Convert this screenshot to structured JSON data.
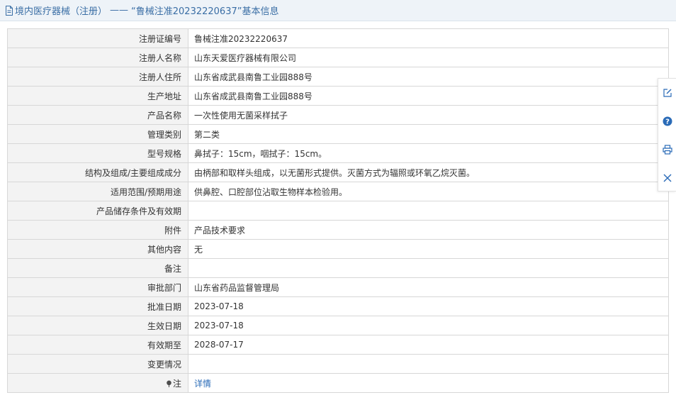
{
  "header": {
    "category": "境内医疗器械（注册）",
    "separator": "——",
    "title": "“鲁械注准20232220637”基本信息"
  },
  "rows": [
    {
      "label": "注册证编号",
      "value": "鲁械注准20232220637"
    },
    {
      "label": "注册人名称",
      "value": "山东天爱医疗器械有限公司"
    },
    {
      "label": "注册人住所",
      "value": "山东省成武县南鲁工业园888号"
    },
    {
      "label": "生产地址",
      "value": "山东省成武县南鲁工业园888号"
    },
    {
      "label": "产品名称",
      "value": "一次性使用无菌采样拭子"
    },
    {
      "label": "管理类别",
      "value": "第二类"
    },
    {
      "label": "型号规格",
      "value": "鼻拭子：15cm，咽拭子：15cm。"
    },
    {
      "label": "结构及组成/主要组成成分",
      "value": "由柄部和取样头组成，以无菌形式提供。灭菌方式为辐照或环氧乙烷灭菌。"
    },
    {
      "label": "适用范围/预期用途",
      "value": "供鼻腔、口腔部位沾取生物样本检验用。"
    },
    {
      "label": "产品储存条件及有效期",
      "value": ""
    },
    {
      "label": "附件",
      "value": "产品技术要求"
    },
    {
      "label": "其他内容",
      "value": "无"
    },
    {
      "label": "备注",
      "value": ""
    },
    {
      "label": "审批部门",
      "value": "山东省药品监督管理局"
    },
    {
      "label": "批准日期",
      "value": "2023-07-18"
    },
    {
      "label": "生效日期",
      "value": "2023-07-18"
    },
    {
      "label": "有效期至",
      "value": "2028-07-17"
    },
    {
      "label": "变更情况",
      "value": ""
    }
  ],
  "note_row": {
    "label": "注",
    "link": "详情",
    "icon": "pin-icon"
  },
  "side_toolbar": {
    "icons": [
      "edit-icon",
      "help-icon",
      "print-icon",
      "close-icon"
    ],
    "accent_color": "#2a6bb7"
  }
}
